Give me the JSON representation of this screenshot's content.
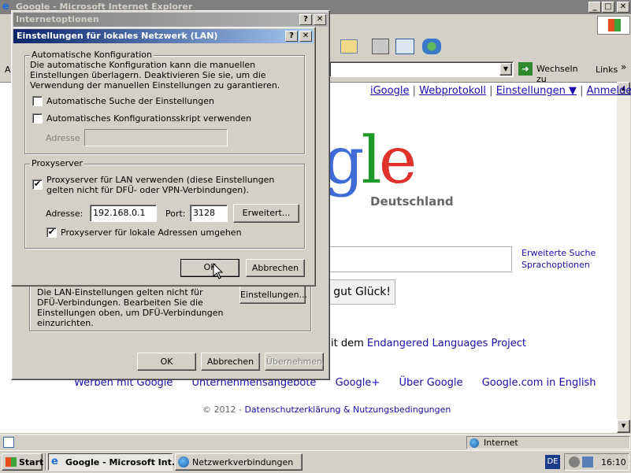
{
  "browser": {
    "title": "Google - Microsoft Internet Explorer",
    "go_button": "Wechseln zu",
    "links_label": "Links",
    "address_prefix": "A",
    "status_zone": "Internet"
  },
  "google": {
    "top_links": [
      "iGoogle",
      "Webprotokoll",
      "Einstellungen ▼",
      "Anmelden"
    ],
    "logo_partial": "gle",
    "country": "Deutschland",
    "adv_search": "Erweiterte Suche",
    "lang_options": "Sprachoptionen",
    "lucky_button": "uf gut Glück!",
    "promo_prefix": "it dem ",
    "promo_link": "Endangered Languages Project",
    "footer_links": [
      "Werben mit Google",
      "Unternehmensangebote",
      "Google+",
      "Über Google",
      "Google.com in English"
    ],
    "copyright": "© 2012 - ",
    "privacy": "Datenschutzerklärung & Nutzungsbedingungen"
  },
  "internet_options": {
    "title": "Internetoptionen",
    "lan_text": "Die LAN-Einstellungen gelten nicht für DFÜ-Verbindungen. Bearbeiten Sie die Einstellungen oben, um DFÜ-Verbindungen einzurichten.",
    "lan_button": "Einstellungen...",
    "ok": "OK",
    "cancel": "Abbrechen",
    "apply": "Übernehmen"
  },
  "lan_dialog": {
    "title": "Einstellungen für lokales Netzwerk (LAN)",
    "auto_group": "Automatische Konfiguration",
    "auto_desc": "Die automatische Konfiguration kann die manuellen Einstellungen überlagern. Deaktivieren Sie sie, um die Verwendung der manuellen Einstellungen zu garantieren.",
    "auto_detect": "Automatische Suche der Einstellungen",
    "auto_script": "Automatisches Konfigurationsskript verwenden",
    "address_label": "Adresse",
    "proxy_group": "Proxyserver",
    "proxy_use": "Proxyserver für LAN verwenden (diese Einstellungen gelten nicht für DFÜ- oder VPN-Verbindungen).",
    "proxy_address_label": "Adresse:",
    "proxy_address": "192.168.0.1",
    "port_label": "Port:",
    "port": "3128",
    "advanced": "Erweitert...",
    "bypass_local": "Proxyserver für lokale Adressen umgehen",
    "ok": "OK",
    "cancel": "Abbrechen",
    "check": "✔"
  },
  "taskbar": {
    "start": "Start",
    "task1": "Google - Microsoft Int...",
    "task2": "Netzwerkverbindungen",
    "lang": "DE",
    "time": "16:10"
  }
}
